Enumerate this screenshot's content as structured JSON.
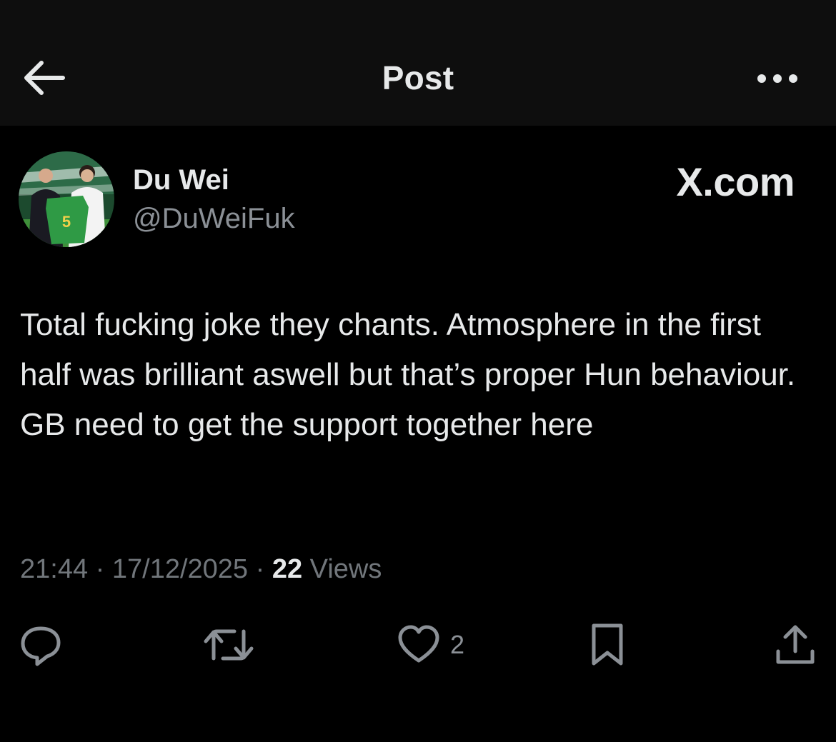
{
  "header": {
    "back_icon": "arrow-left-icon",
    "title": "Post",
    "more_icon": "more-horizontal-icon"
  },
  "author": {
    "display_name": "Du Wei",
    "handle": "@DuWeiFuk",
    "avatar_jersey_number": "5"
  },
  "brand": "X.com",
  "tweet": {
    "text": "Total fucking joke they chants. Atmosphere in the first half was brilliant aswell but that’s proper Hun behaviour. GB need to get the support together here"
  },
  "meta": {
    "time": "21:44",
    "separator": " · ",
    "date": "17/12/2025",
    "views_count": "22",
    "views_label": " Views"
  },
  "actions": {
    "reply_icon": "reply-icon",
    "retweet_icon": "retweet-icon",
    "like_icon": "heart-icon",
    "like_count": "2",
    "bookmark_icon": "bookmark-icon",
    "share_icon": "share-icon"
  },
  "colors": {
    "background": "#000000",
    "header_background": "#0e0e0e",
    "primary_text": "#e7e9ea",
    "secondary_text": "#71767b"
  }
}
